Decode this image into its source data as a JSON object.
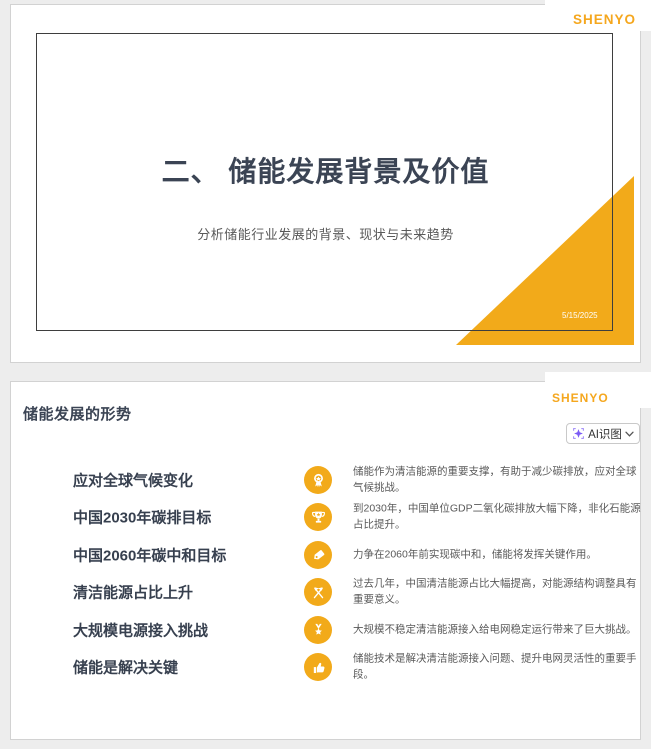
{
  "colors": {
    "accent": "#F2AA1A",
    "brand": "#F5A71E",
    "title_text": "#3B4454",
    "label_text": "#37404F",
    "body_text": "#595959",
    "page_bg": "#EDEDED",
    "sparkle": "#7B5BF5"
  },
  "brand": {
    "logo": "SHENYO"
  },
  "slide1": {
    "title": "二、 储能发展背景及价值",
    "subtitle": "分析储能行业发展的背景、现状与未来趋势",
    "date": "5/15/2025"
  },
  "slide2": {
    "title": "储能发展的形势",
    "ai_button": {
      "label": "AI识图",
      "icon": "sparkle-icon",
      "dropdown_icon": "chevron-down-icon"
    },
    "rows": [
      {
        "label": "应对全球气候变化",
        "icon": "award-ribbon-icon",
        "desc": "储能作为清洁能源的重要支撑，有助于减少碳排放，应对全球气候挑战。"
      },
      {
        "label": "中国2030年碳排目标",
        "icon": "trophy-icon",
        "desc": "到2030年，中国单位GDP二氧化碳排放大幅下降，非化石能源占比提升。"
      },
      {
        "label": "中国2060年碳中和目标",
        "icon": "price-tag-icon",
        "desc": "力争在2060年前实现碳中和，储能将发挥关键作用。"
      },
      {
        "label": "清洁能源占比上升",
        "icon": "crossed-flags-icon",
        "desc": "过去几年，中国清洁能源占比大幅提高，对能源结构调整具有重要意义。"
      },
      {
        "label": "大规模电源接入挑战",
        "icon": "medal-icon",
        "desc": "大规模不稳定清洁能源接入给电网稳定运行带来了巨大挑战。"
      },
      {
        "label": "储能是解决关键",
        "icon": "thumbs-up-icon",
        "desc": "储能技术是解决清洁能源接入问题、提升电网灵活性的重要手段。"
      }
    ]
  }
}
